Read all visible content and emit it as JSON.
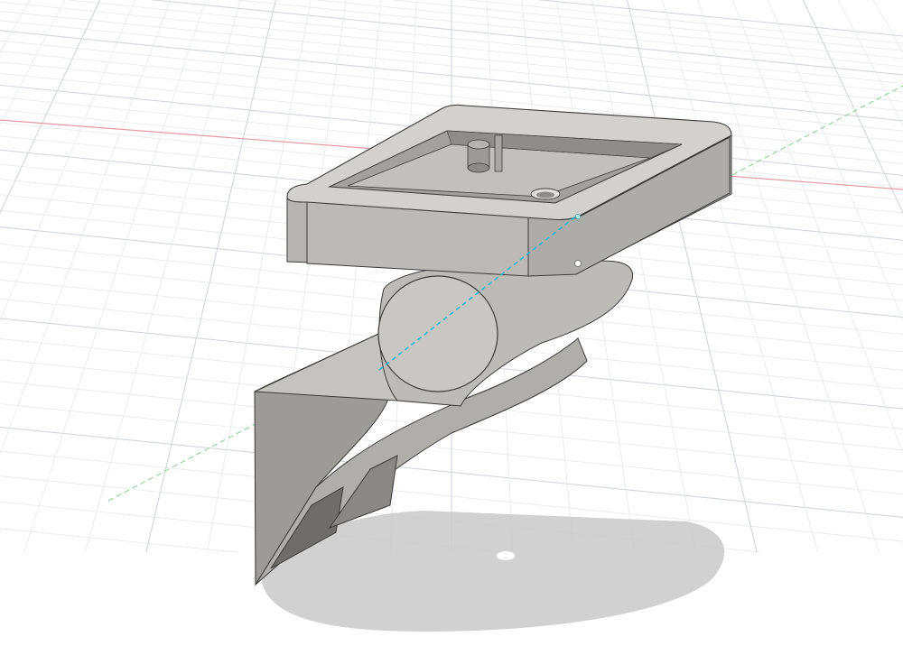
{
  "app": {
    "view": "3d-design-viewport",
    "visible_text": []
  },
  "scene": {
    "background_color": "#ffffff",
    "grid": {
      "visible": true,
      "minor_color": "#e6e8eb",
      "major_color": "#d2d6da"
    },
    "axes": {
      "x_axis_color": "#e59aa0",
      "y_axis_color": "#8fd39a",
      "z_axis_color": "#21b8c9"
    },
    "model": {
      "description_icon": "cube-icon",
      "body_color": "#c5c3bf",
      "shade_color": "#9d9b97",
      "dark_color": "#6f6d69",
      "edge_color": "#3a3a3a"
    },
    "shadow_color": "#c9c9c9"
  }
}
